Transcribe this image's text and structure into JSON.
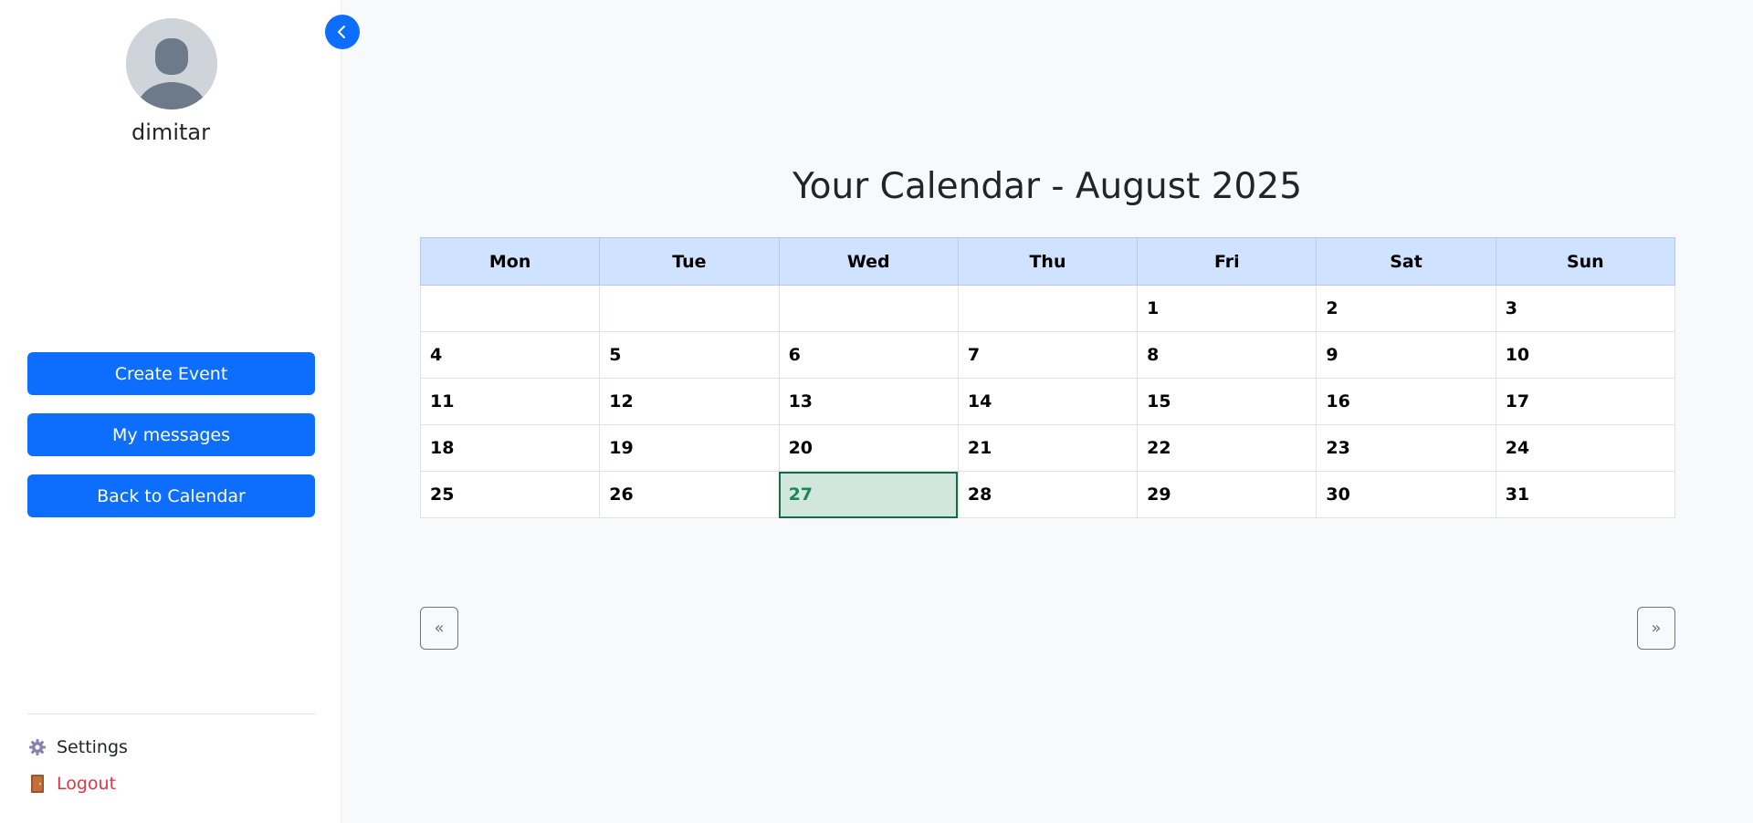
{
  "sidebar": {
    "username": "dimitar",
    "buttons": {
      "create_event": "Create Event",
      "my_messages": "My messages",
      "back_to_calendar": "Back to Calendar"
    },
    "links": {
      "settings": "Settings",
      "logout": "Logout"
    },
    "icons": {
      "avatar": "user-avatar-icon",
      "settings": "gear-icon",
      "logout": "door-icon",
      "collapse": "chevron-left-icon"
    }
  },
  "calendar": {
    "title": "Your Calendar - August 2025",
    "weekdays": [
      "Mon",
      "Tue",
      "Wed",
      "Thu",
      "Fri",
      "Sat",
      "Sun"
    ],
    "weeks": [
      [
        "",
        "",
        "",
        "",
        "1",
        "2",
        "3"
      ],
      [
        "4",
        "5",
        "6",
        "7",
        "8",
        "9",
        "10"
      ],
      [
        "11",
        "12",
        "13",
        "14",
        "15",
        "16",
        "17"
      ],
      [
        "18",
        "19",
        "20",
        "21",
        "22",
        "23",
        "24"
      ],
      [
        "25",
        "26",
        "27",
        "28",
        "29",
        "30",
        "31"
      ]
    ],
    "today": "27",
    "prev_label": "«",
    "next_label": "»"
  },
  "colors": {
    "primary": "#0d6efd",
    "header_bg": "#cfe2ff",
    "today_bg": "#d1e7dd",
    "today_text": "#198754",
    "logout": "#dc3545"
  }
}
